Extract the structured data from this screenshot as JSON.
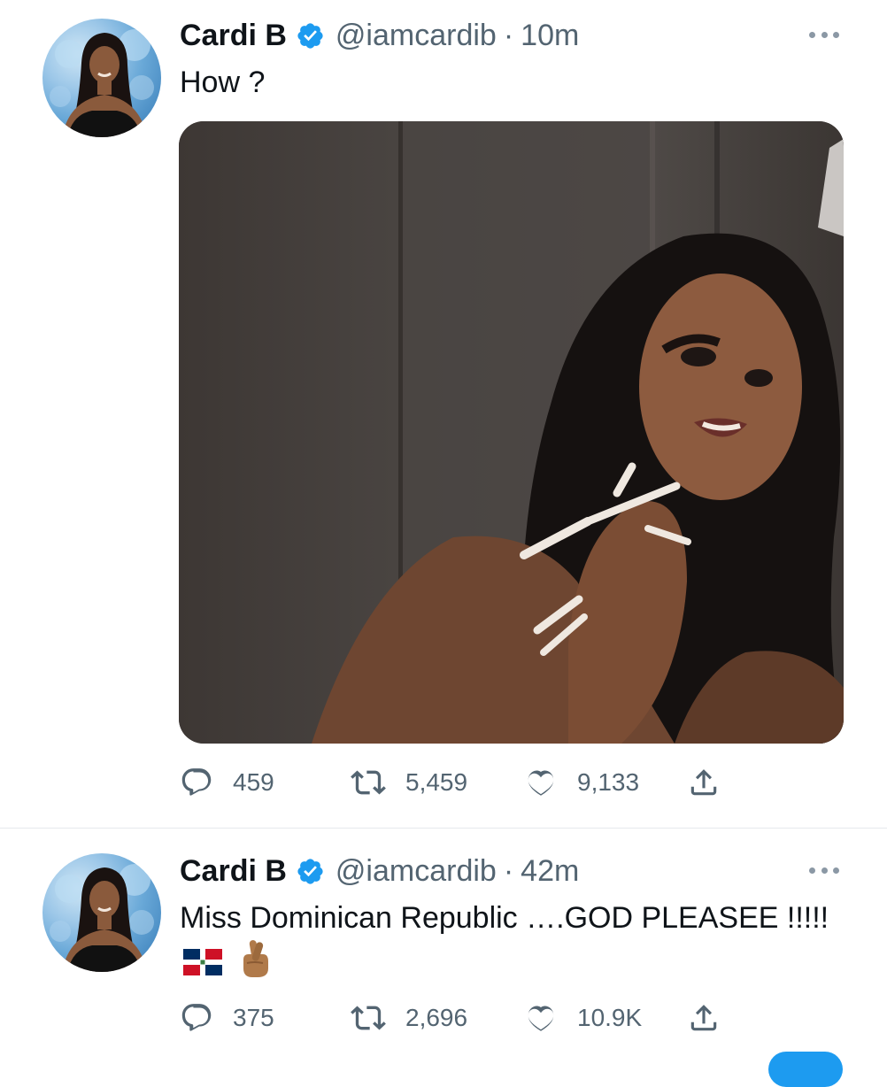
{
  "tweets": [
    {
      "author": {
        "name": "Cardi B",
        "handle": "@iamcardib",
        "verified": true
      },
      "time": "10m",
      "separator": "·",
      "text": "How ?",
      "has_media": true,
      "stats": {
        "replies": "459",
        "retweets": "5,459",
        "likes": "9,133"
      }
    },
    {
      "author": {
        "name": "Cardi B",
        "handle": "@iamcardib",
        "verified": true
      },
      "time": "42m",
      "separator": "·",
      "text": "Miss Dominican Republic ….GOD PLEASEE !!!!!",
      "has_media": false,
      "stats": {
        "replies": "375",
        "retweets": "2,696",
        "likes": "10.9K"
      }
    }
  ],
  "icons": {
    "verified": "verified-badge-icon",
    "more": "more-options-icon",
    "reply": "reply-icon",
    "retweet": "retweet-icon",
    "like": "like-icon",
    "share": "share-icon",
    "flag": "dominican-republic-flag-emoji",
    "fingers": "crossed-fingers-emoji"
  },
  "colors": {
    "verified_blue": "#1d9bf0",
    "secondary_text": "#536471",
    "primary_text": "#0f1419"
  }
}
